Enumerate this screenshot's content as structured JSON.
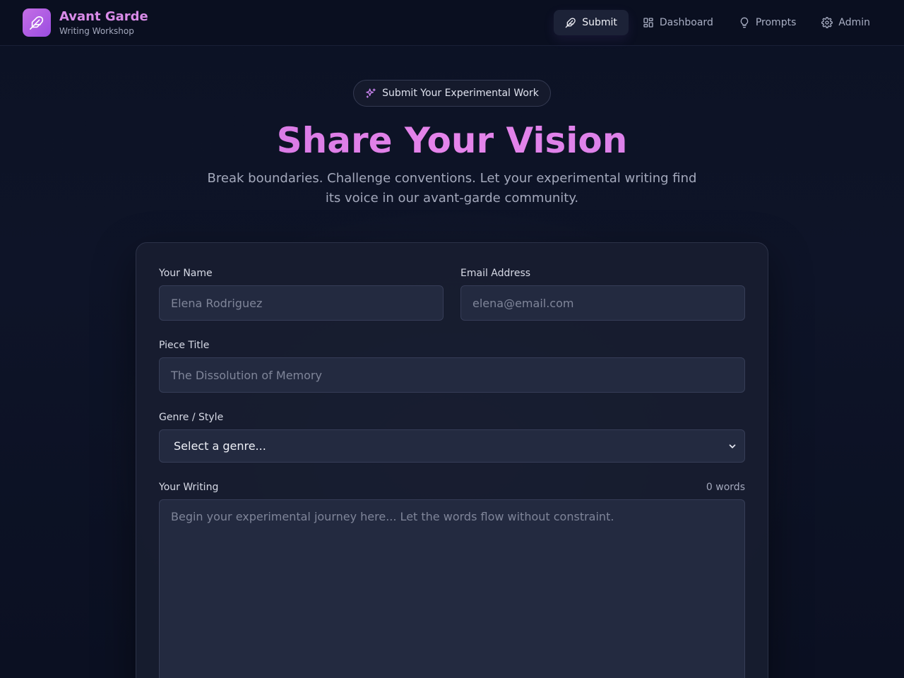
{
  "brand": {
    "title": "Avant Garde",
    "subtitle": "Writing Workshop"
  },
  "nav": [
    {
      "label": "Submit",
      "icon": "feather-icon",
      "active": true
    },
    {
      "label": "Dashboard",
      "icon": "grid-icon",
      "active": false
    },
    {
      "label": "Prompts",
      "icon": "lightbulb-icon",
      "active": false
    },
    {
      "label": "Admin",
      "icon": "gear-icon",
      "active": false
    }
  ],
  "hero": {
    "badge": "Submit Your Experimental Work",
    "badge_icon": "sparkles-icon",
    "title": "Share Your Vision",
    "description": "Break boundaries. Challenge conventions. Let your experimental writing find its voice in our avant-garde community."
  },
  "form": {
    "name": {
      "label": "Your Name",
      "value": "",
      "placeholder": "Elena Rodriguez"
    },
    "email": {
      "label": "Email Address",
      "value": "",
      "placeholder": "elena@email.com"
    },
    "title": {
      "label": "Piece Title",
      "value": "",
      "placeholder": "The Dissolution of Memory"
    },
    "genre": {
      "label": "Genre / Style",
      "selected": "Select a genre..."
    },
    "writing": {
      "label": "Your Writing",
      "word_count": "0 words",
      "value": "",
      "placeholder": "Begin your experimental journey here... Let the words flow without constraint."
    }
  },
  "colors": {
    "accent": "#d98be8",
    "accent_gradient_start": "#c56ee6",
    "accent_gradient_end": "#9a4de0",
    "background": "#0c1224",
    "card": "#181d30",
    "field": "#232a40"
  }
}
